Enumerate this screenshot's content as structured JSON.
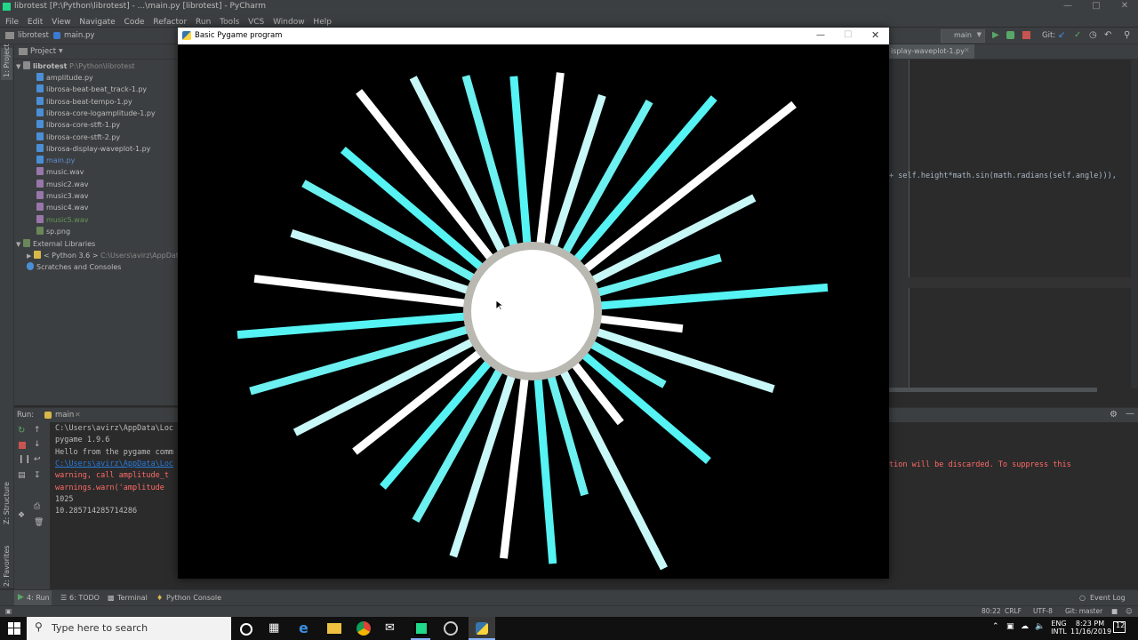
{
  "ide": {
    "title": "librotest [P:\\Python\\librotest] - ...\\main.py [librotest] - PyCharm",
    "menu": [
      "File",
      "Edit",
      "View",
      "Navigate",
      "Code",
      "Refactor",
      "Run",
      "Tools",
      "VCS",
      "Window",
      "Help"
    ],
    "breadcrumb": [
      "librotest",
      "main.py"
    ],
    "run_config": "main",
    "git_label": "Git:",
    "editor_tab": "isplay-waveplot-1.py",
    "code_line": "+ self.height*math.sin(math.radians(self.angle))),"
  },
  "project": {
    "header": "Project",
    "root": {
      "name": "librotest",
      "path": "P:\\Python\\librotest"
    },
    "files": [
      {
        "name": "amplitude.py",
        "type": "py",
        "color": "#bbbbbb"
      },
      {
        "name": "librosa-beat-beat_track-1.py",
        "type": "py",
        "color": "#bbbbbb"
      },
      {
        "name": "librosa-beat-tempo-1.py",
        "type": "py",
        "color": "#bbbbbb"
      },
      {
        "name": "librosa-core-logamplitude-1.py",
        "type": "py",
        "color": "#bbbbbb"
      },
      {
        "name": "librosa-core-stft-1.py",
        "type": "py",
        "color": "#bbbbbb"
      },
      {
        "name": "librosa-core-stft-2.py",
        "type": "py",
        "color": "#bbbbbb"
      },
      {
        "name": "librosa-display-waveplot-1.py",
        "type": "py",
        "color": "#bbbbbb"
      },
      {
        "name": "main.py",
        "type": "py",
        "color": "#5f8dd3"
      },
      {
        "name": "music.wav",
        "type": "wav",
        "color": "#bbbbbb"
      },
      {
        "name": "music2.wav",
        "type": "wav",
        "color": "#bbbbbb"
      },
      {
        "name": "music3.wav",
        "type": "wav",
        "color": "#bbbbbb"
      },
      {
        "name": "music4.wav",
        "type": "wav",
        "color": "#bbbbbb"
      },
      {
        "name": "music5.wav",
        "type": "wav",
        "color": "#629755"
      },
      {
        "name": "sp.png",
        "type": "png",
        "color": "#bbbbbb"
      }
    ],
    "external_libraries": "External Libraries",
    "python_sdk": "< Python 3.6 >",
    "python_path": "C:\\Users\\avirz\\AppData\\Lo",
    "scratches": "Scratches and Consoles"
  },
  "run": {
    "label": "Run:",
    "tab": "main",
    "lines": [
      {
        "text": "C:\\Users\\avirz\\AppData\\Loc",
        "color": "#bbbbbb"
      },
      {
        "text": "pygame 1.9.6",
        "color": "#bbbbbb"
      },
      {
        "text": "Hello from the pygame comm",
        "color": "#bbbbbb"
      },
      {
        "text": "C:\\Users\\avirz\\AppData\\Loc",
        "color": "#287bde"
      },
      {
        "text": " warning, call amplitude_t",
        "color": "#ff6b68"
      },
      {
        "text": "  warnings.warn('amplitude",
        "color": "#ff6b68"
      },
      {
        "text": "1025",
        "color": "#bbbbbb"
      },
      {
        "text": "10.285714285714286",
        "color": "#bbbbbb"
      }
    ],
    "right_warning": "tion will be discarded. To suppress this"
  },
  "bottom_tabs": {
    "run": "4: Run",
    "todo": "6: TODO",
    "terminal": "Terminal",
    "python_console": "Python Console",
    "event_log": "Event Log"
  },
  "status": {
    "position": "80:22",
    "line_sep": "CRLF",
    "encoding": "UTF-8",
    "git": "Git: master"
  },
  "taskbar": {
    "search_placeholder": "Type here to search",
    "lang_top": "ENG",
    "lang_bottom": "INTL",
    "time": "8:23 PM",
    "date": "11/16/2019",
    "notifications": "12"
  },
  "pygame": {
    "title": "Basic Pygame program",
    "bar_colors": [
      "#55f3f3",
      "#ffffff",
      "#c8f7f7",
      "#6cf0f0"
    ],
    "circle_fill": "#ffffff",
    "circle_ring": "#b9b9b2"
  }
}
